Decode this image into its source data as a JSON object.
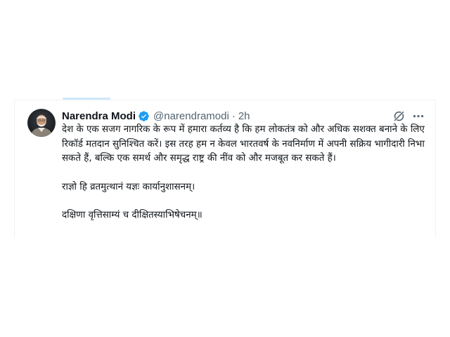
{
  "tweet": {
    "author": {
      "display_name": "Narendra Modi",
      "handle": "@narendramodi",
      "verified": true,
      "avatar": "profile-photo"
    },
    "separator": "·",
    "timestamp": "2h",
    "body": {
      "paragraph1": "देश के एक सजग नागरिक के रूप में हमारा कर्तव्य है कि हम लोकतंत्र को और अधिक सशक्त बनाने के लिए रिकॉर्ड मतदान सुनिश्चित करें। इस तरह हम न केवल भारतवर्ष के नवनिर्माण में अपनी सक्रिय भागीदारी निभा सकते हैं, बल्कि एक समर्थ और समृद्ध राष्ट्र की नींव को और मजबूत कर सकते हैं।",
      "paragraph2": "राज्ञो हि व्रतमुत्थानं यज्ञः कार्यानुशासनम्।",
      "paragraph3": "दक्षिणा वृत्तिसाम्यं च दीक्षितस्याभिषेचनम्॥"
    },
    "icons": {
      "verified": "verified-badge-icon",
      "grok": "grok-icon",
      "more": "more-options-icon"
    }
  },
  "colors": {
    "primary_text": "#0f1419",
    "secondary_text": "#536471",
    "verified_blue": "#1d9bf0",
    "border": "#eff3f4",
    "tab_indicator": "#cfe8fb"
  }
}
